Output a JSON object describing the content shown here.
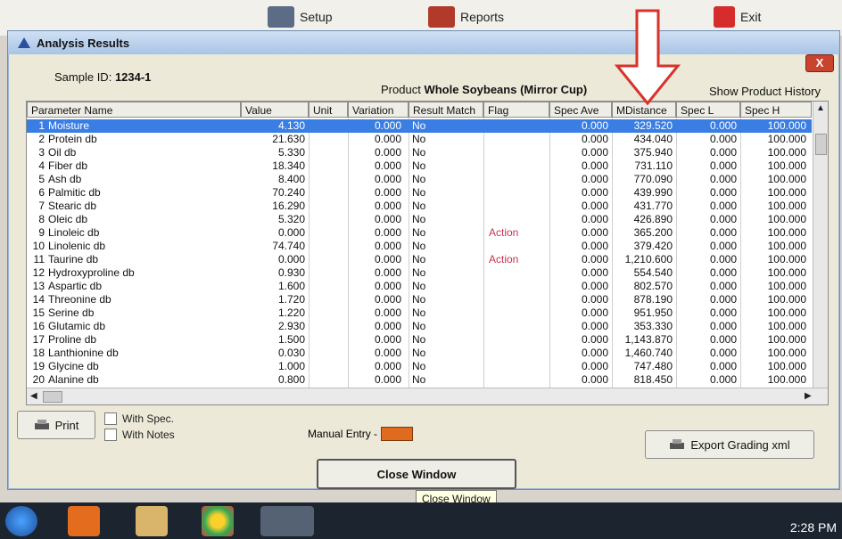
{
  "toolbar": {
    "item1": "Setup",
    "item2": "Reports",
    "item3": "Exit"
  },
  "window": {
    "title": "Analysis Results",
    "close_label": "X"
  },
  "header": {
    "sample_label": "Sample ID:",
    "sample_value": "1234-1",
    "product_label": "Product",
    "product_value": "Whole Soybeans (Mirror Cup)",
    "history_label": "Show Product History"
  },
  "table": {
    "columns": [
      "Parameter Name",
      "Value",
      "Unit",
      "Variation",
      "Result Match",
      "Flag",
      "Spec Ave",
      "MDistance",
      "Spec L",
      "Spec H"
    ],
    "rows": [
      {
        "n": "1",
        "name": "Moisture",
        "value": "4.130",
        "variation": "0.000",
        "match": "No",
        "flag": "",
        "spec_ave": "0.000",
        "mdist": "329.520",
        "spec_l": "0.000",
        "spec_h": "100.000"
      },
      {
        "n": "2",
        "name": "Protein db",
        "value": "21.630",
        "variation": "0.000",
        "match": "No",
        "flag": "",
        "spec_ave": "0.000",
        "mdist": "434.040",
        "spec_l": "0.000",
        "spec_h": "100.000"
      },
      {
        "n": "3",
        "name": "Oil db",
        "value": "5.330",
        "variation": "0.000",
        "match": "No",
        "flag": "",
        "spec_ave": "0.000",
        "mdist": "375.940",
        "spec_l": "0.000",
        "spec_h": "100.000"
      },
      {
        "n": "4",
        "name": "Fiber db",
        "value": "18.340",
        "variation": "0.000",
        "match": "No",
        "flag": "",
        "spec_ave": "0.000",
        "mdist": "731.110",
        "spec_l": "0.000",
        "spec_h": "100.000"
      },
      {
        "n": "5",
        "name": "Ash db",
        "value": "8.400",
        "variation": "0.000",
        "match": "No",
        "flag": "",
        "spec_ave": "0.000",
        "mdist": "770.090",
        "spec_l": "0.000",
        "spec_h": "100.000"
      },
      {
        "n": "6",
        "name": "Palmitic db",
        "value": "70.240",
        "variation": "0.000",
        "match": "No",
        "flag": "",
        "spec_ave": "0.000",
        "mdist": "439.990",
        "spec_l": "0.000",
        "spec_h": "100.000"
      },
      {
        "n": "7",
        "name": "Stearic db",
        "value": "16.290",
        "variation": "0.000",
        "match": "No",
        "flag": "",
        "spec_ave": "0.000",
        "mdist": "431.770",
        "spec_l": "0.000",
        "spec_h": "100.000"
      },
      {
        "n": "8",
        "name": "Oleic db",
        "value": "5.320",
        "variation": "0.000",
        "match": "No",
        "flag": "",
        "spec_ave": "0.000",
        "mdist": "426.890",
        "spec_l": "0.000",
        "spec_h": "100.000"
      },
      {
        "n": "9",
        "name": "Linoleic db",
        "value": "0.000",
        "variation": "0.000",
        "match": "No",
        "flag": "Action",
        "spec_ave": "0.000",
        "mdist": "365.200",
        "spec_l": "0.000",
        "spec_h": "100.000"
      },
      {
        "n": "10",
        "name": "Linolenic db",
        "value": "74.740",
        "variation": "0.000",
        "match": "No",
        "flag": "",
        "spec_ave": "0.000",
        "mdist": "379.420",
        "spec_l": "0.000",
        "spec_h": "100.000"
      },
      {
        "n": "11",
        "name": "Taurine db",
        "value": "0.000",
        "variation": "0.000",
        "match": "No",
        "flag": "Action",
        "spec_ave": "0.000",
        "mdist": "1,210.600",
        "spec_l": "0.000",
        "spec_h": "100.000"
      },
      {
        "n": "12",
        "name": "Hydroxyproline db",
        "value": "0.930",
        "variation": "0.000",
        "match": "No",
        "flag": "",
        "spec_ave": "0.000",
        "mdist": "554.540",
        "spec_l": "0.000",
        "spec_h": "100.000"
      },
      {
        "n": "13",
        "name": "Aspartic db",
        "value": "1.600",
        "variation": "0.000",
        "match": "No",
        "flag": "",
        "spec_ave": "0.000",
        "mdist": "802.570",
        "spec_l": "0.000",
        "spec_h": "100.000"
      },
      {
        "n": "14",
        "name": "Threonine db",
        "value": "1.720",
        "variation": "0.000",
        "match": "No",
        "flag": "",
        "spec_ave": "0.000",
        "mdist": "878.190",
        "spec_l": "0.000",
        "spec_h": "100.000"
      },
      {
        "n": "15",
        "name": "Serine db",
        "value": "1.220",
        "variation": "0.000",
        "match": "No",
        "flag": "",
        "spec_ave": "0.000",
        "mdist": "951.950",
        "spec_l": "0.000",
        "spec_h": "100.000"
      },
      {
        "n": "16",
        "name": "Glutamic db",
        "value": "2.930",
        "variation": "0.000",
        "match": "No",
        "flag": "",
        "spec_ave": "0.000",
        "mdist": "353.330",
        "spec_l": "0.000",
        "spec_h": "100.000"
      },
      {
        "n": "17",
        "name": "Proline db",
        "value": "1.500",
        "variation": "0.000",
        "match": "No",
        "flag": "",
        "spec_ave": "0.000",
        "mdist": "1,143.870",
        "spec_l": "0.000",
        "spec_h": "100.000"
      },
      {
        "n": "18",
        "name": "Lanthionine db",
        "value": "0.030",
        "variation": "0.000",
        "match": "No",
        "flag": "",
        "spec_ave": "0.000",
        "mdist": "1,460.740",
        "spec_l": "0.000",
        "spec_h": "100.000"
      },
      {
        "n": "19",
        "name": "Glycine db",
        "value": "1.000",
        "variation": "0.000",
        "match": "No",
        "flag": "",
        "spec_ave": "0.000",
        "mdist": "747.480",
        "spec_l": "0.000",
        "spec_h": "100.000"
      },
      {
        "n": "20",
        "name": "Alanine db",
        "value": "0.800",
        "variation": "0.000",
        "match": "No",
        "flag": "",
        "spec_ave": "0.000",
        "mdist": "818.450",
        "spec_l": "0.000",
        "spec_h": "100.000"
      }
    ]
  },
  "footer": {
    "print_label": "Print",
    "with_spec": "With Spec.",
    "with_notes": "With Notes",
    "manual_entry": "Manual Entry -",
    "export_label": "Export Grading xml",
    "close_window": "Close Window",
    "tooltip": "Close Window"
  },
  "taskbar": {
    "time": "2:28 PM"
  },
  "colors": {
    "selection": "#3a7ee3",
    "flag": "#c8334f",
    "manual_swatch": "#e06b1f",
    "annotation_arrow": "#ffffff"
  }
}
